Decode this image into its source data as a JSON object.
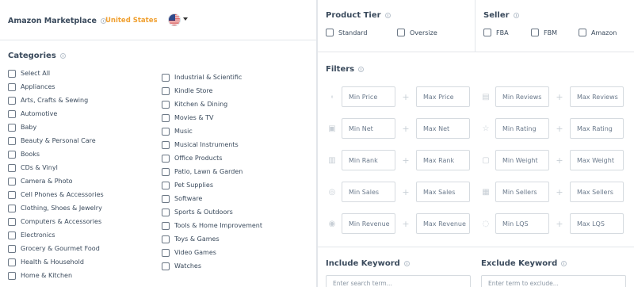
{
  "marketplace": {
    "label": "Amazon Marketplace",
    "country": "United States",
    "flag_icon": "us-flag-icon",
    "accent_color": "#f0a030"
  },
  "categories": {
    "title": "Categories",
    "column1": [
      "Select All",
      "Appliances",
      "Arts, Crafts & Sewing",
      "Automotive",
      "Baby",
      "Beauty & Personal Care",
      "Books",
      "CDs & Vinyl",
      "Camera & Photo",
      "Cell Phones & Accessories",
      "Clothing, Shoes & Jewelry",
      "Computers & Accessories",
      "Electronics",
      "Grocery & Gourmet Food",
      "Health & Household",
      "Home & Kitchen"
    ],
    "column2": [
      "Industrial & Scientific",
      "Kindle Store",
      "Kitchen & Dining",
      "Movies & TV",
      "Music",
      "Musical Instruments",
      "Office Products",
      "Patio, Lawn & Garden",
      "Pet Supplies",
      "Software",
      "Sports & Outdoors",
      "Tools & Home Improvement",
      "Toys & Games",
      "Video Games",
      "Watches"
    ]
  },
  "product_tier": {
    "title": "Product Tier",
    "options": [
      "Standard",
      "Oversize"
    ]
  },
  "seller": {
    "title": "Seller",
    "options": [
      "FBA",
      "FBM",
      "Amazon"
    ]
  },
  "filters": {
    "title": "Filters",
    "rows": [
      {
        "icon": "price-tag-icon",
        "min": "Min Price",
        "max": "Max Price",
        "icon2": "reviews-icon",
        "min2": "Min Reviews",
        "max2": "Max Reviews"
      },
      {
        "icon": "net-icon",
        "min": "Min Net",
        "max": "Max Net",
        "icon2": "star-icon",
        "min2": "Min Rating",
        "max2": "Max Rating"
      },
      {
        "icon": "rank-icon",
        "min": "Min Rank",
        "max": "Max Rank",
        "icon2": "weight-icon",
        "min2": "Min Weight",
        "max2": "Max Weight"
      },
      {
        "icon": "sales-icon",
        "min": "Min Sales",
        "max": "Max Sales",
        "icon2": "sellers-icon",
        "min2": "Min Sellers",
        "max2": "Max Sellers"
      },
      {
        "icon": "revenue-icon",
        "min": "Min Revenue",
        "max": "Max Revenue",
        "icon2": "eye-icon",
        "min2": "Min LQS",
        "max2": "Max LQS"
      }
    ]
  },
  "keywords": {
    "include_title": "Include Keyword",
    "include_placeholder": "Enter search term...",
    "exclude_title": "Exclude Keyword",
    "exclude_placeholder": "Enter term to exclude..."
  }
}
